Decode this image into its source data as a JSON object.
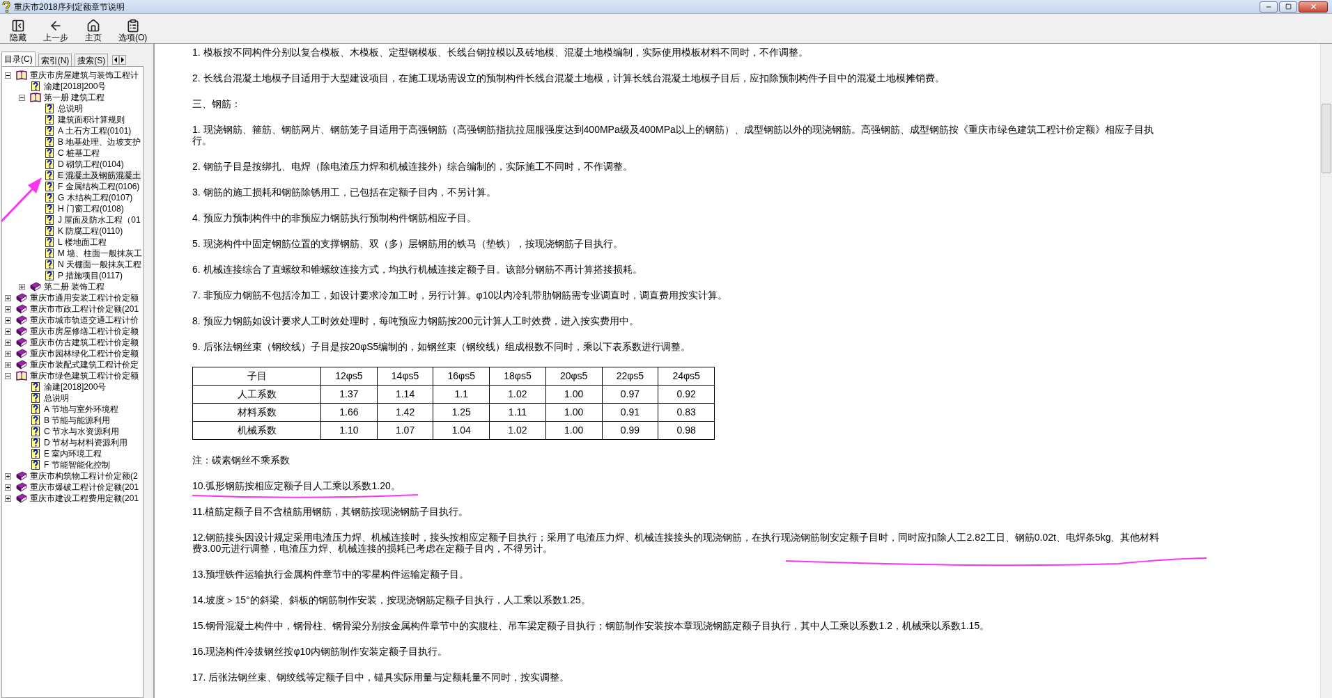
{
  "window": {
    "title": "重庆市2018序列定额章节说明"
  },
  "toolbar": [
    {
      "kind": "hide",
      "label": "隐藏"
    },
    {
      "kind": "back",
      "label": "上一步"
    },
    {
      "kind": "home",
      "label": "主页"
    },
    {
      "kind": "options",
      "label": "选项(O)"
    }
  ],
  "tabs": [
    {
      "label": "目录(C)",
      "selected": true
    },
    {
      "label": "索引(N)",
      "selected": false
    },
    {
      "label": "搜索(S)",
      "selected": false
    }
  ],
  "tree": [
    {
      "label": "重庆市房屋建筑与装饰工程计",
      "kind": "book",
      "expanded": true,
      "selected": false,
      "children": [
        {
          "label": "渝建[2018]200号",
          "kind": "page",
          "selected": false
        },
        {
          "label": "第一册 建筑工程",
          "kind": "book",
          "expanded": true,
          "selected": false,
          "children": [
            {
              "label": "总说明",
              "kind": "page",
              "selected": false
            },
            {
              "label": "建筑面积计算规则",
              "kind": "page",
              "selected": false
            },
            {
              "label": "A 土石方工程(0101)",
              "kind": "page",
              "selected": false
            },
            {
              "label": "B 地基处理、边坡支护",
              "kind": "page",
              "selected": false
            },
            {
              "label": "C 桩基工程",
              "kind": "page",
              "selected": false
            },
            {
              "label": "D 砌筑工程(0104)",
              "kind": "page",
              "selected": false
            },
            {
              "label": "E 混凝土及钢筋混凝土",
              "kind": "page",
              "selected": true
            },
            {
              "label": "F 金属结构工程(0106)",
              "kind": "page",
              "selected": false
            },
            {
              "label": "G 木结构工程(0107)",
              "kind": "page",
              "selected": false
            },
            {
              "label": "H 门窗工程(0108)",
              "kind": "page",
              "selected": false
            },
            {
              "label": "J 屋面及防水工程（01",
              "kind": "page",
              "selected": false
            },
            {
              "label": "K 防腐工程(0110)",
              "kind": "page",
              "selected": false
            },
            {
              "label": "L 楼地面工程",
              "kind": "page",
              "selected": false
            },
            {
              "label": "M 墙、柱面一般抹灰工",
              "kind": "page",
              "selected": false
            },
            {
              "label": "N 天棚面一般抹灰工程",
              "kind": "page",
              "selected": false
            },
            {
              "label": "P 措施项目(0117)",
              "kind": "page",
              "selected": false
            }
          ]
        },
        {
          "label": "第二册 装饰工程",
          "kind": "book",
          "expanded": false,
          "selected": false
        }
      ]
    },
    {
      "label": "重庆市通用安装工程计价定额",
      "kind": "book",
      "expanded": false,
      "selected": false
    },
    {
      "label": "重庆市市政工程计价定额(201",
      "kind": "book",
      "expanded": false,
      "selected": false
    },
    {
      "label": "重庆市城市轨道交通工程计价",
      "kind": "book",
      "expanded": false,
      "selected": false
    },
    {
      "label": "重庆市房屋修缮工程计价定额",
      "kind": "book",
      "expanded": false,
      "selected": false
    },
    {
      "label": "重庆市仿古建筑工程计价定额",
      "kind": "book",
      "expanded": false,
      "selected": false
    },
    {
      "label": "重庆市园林绿化工程计价定额",
      "kind": "book",
      "expanded": false,
      "selected": false
    },
    {
      "label": "重庆市装配式建筑工程计价定",
      "kind": "book",
      "expanded": false,
      "selected": false
    },
    {
      "label": "重庆市绿色建筑工程计价定额",
      "kind": "book",
      "expanded": true,
      "selected": false,
      "children": [
        {
          "label": "渝建[2018]200号",
          "kind": "page",
          "selected": false
        },
        {
          "label": "总说明",
          "kind": "page",
          "selected": false
        },
        {
          "label": "A 节地与室外环境程",
          "kind": "page",
          "selected": false
        },
        {
          "label": "B 节能与能源利用",
          "kind": "page",
          "selected": false
        },
        {
          "label": "C 节水与水资源利用",
          "kind": "page",
          "selected": false
        },
        {
          "label": "D 节材与材料资源利用",
          "kind": "page",
          "selected": false
        },
        {
          "label": "E 室内环境工程",
          "kind": "page",
          "selected": false
        },
        {
          "label": "F 节能智能化控制",
          "kind": "page",
          "selected": false
        }
      ]
    },
    {
      "label": "重庆市构筑物工程计价定额(2",
      "kind": "book",
      "expanded": false,
      "selected": false
    },
    {
      "label": "重庆市爆破工程计价定额(201",
      "kind": "book",
      "expanded": false,
      "selected": false
    },
    {
      "label": "重庆市建设工程费用定额(201",
      "kind": "book",
      "expanded": false,
      "selected": false
    }
  ],
  "content": [
    {
      "kind": "text",
      "text": "1. 模板按不同构件分别以复合模板、木模板、定型钢模板、长线台钢拉模以及砖地模、混凝土地模编制，实际使用模板材料不同时，不作调整。"
    },
    {
      "kind": "text",
      "text": "2. 长线台混凝土地模子目适用于大型建设项目，在施工现场需设立的预制构件长线台混凝土地模，计算长线台混凝土地模子目后，应扣除预制构件子目中的混凝土地模摊销费。"
    },
    {
      "kind": "text",
      "text": "三、钢筋："
    },
    {
      "kind": "text",
      "text": "1. 现浇钢筋、箍筋、钢筋网片、钢筋笼子目适用于高强钢筋（高强钢筋指抗拉屈服强度达到400MPa级及400MPa以上的钢筋）、成型钢筋以外的现浇钢筋。高强钢筋、成型钢筋按《重庆市绿色建筑工程计价定额》相应子目执行。"
    },
    {
      "kind": "text",
      "text": "2. 钢筋子目是按绑扎、电焊（除电渣压力焊和机械连接外）综合编制的，实际施工不同时，不作调整。"
    },
    {
      "kind": "text",
      "text": "3. 钢筋的施工损耗和钢筋除锈用工，已包括在定额子目内，不另计算。"
    },
    {
      "kind": "text",
      "text": "4. 预应力预制构件中的非预应力钢筋执行预制构件钢筋相应子目。"
    },
    {
      "kind": "text",
      "text": "5. 现浇构件中固定钢筋位置的支撑钢筋、双（多）层钢筋用的铁马（垫铁），按现浇钢筋子目执行。"
    },
    {
      "kind": "text",
      "text": "6. 机械连接综合了直螺纹和锥螺纹连接方式，均执行机械连接定额子目。该部分钢筋不再计算搭接损耗。"
    },
    {
      "kind": "text",
      "text": "7. 非预应力钢筋不包括冷加工，如设计要求冷加工时，另行计算。φ10以内冷轧带肋钢筋需专业调直时，调直费用按实计算。"
    },
    {
      "kind": "text",
      "text": "8. 预应力钢筋如设计要求人工时效处理时，每吨预应力钢筋按200元计算人工时效费，进入按实费用中。"
    },
    {
      "kind": "text",
      "text": "9. 后张法钢丝束（钢绞线）子目是按20φS5编制的，如钢丝束（钢绞线）组成根数不同时，乘以下表系数进行调整。"
    },
    {
      "kind": "table",
      "columns": [
        "子目",
        "12φs5",
        "14φs5",
        "16φs5",
        "18φs5",
        "20φs5",
        "22φs5",
        "24φs5"
      ],
      "rows": [
        [
          "人工系数",
          "1.37",
          "1.14",
          "1.1",
          "1.02",
          "1.00",
          "0.97",
          "0.92"
        ],
        [
          "材料系数",
          "1.66",
          "1.42",
          "1.25",
          "1.11",
          "1.00",
          "0.91",
          "0.83"
        ],
        [
          "机械系数",
          "1.10",
          "1.07",
          "1.04",
          "1.02",
          "1.00",
          "0.99",
          "0.98"
        ]
      ]
    },
    {
      "kind": "text",
      "text": "注：碳素钢丝不乘系数"
    },
    {
      "kind": "underlined",
      "text": "10.弧形钢筋按相应定额子目人工乘以系数1.20。"
    },
    {
      "kind": "text",
      "text": "11.植筋定额子目不含植筋用钢筋，其钢筋按现浇钢筋子目执行。"
    },
    {
      "kind": "tail_underlined",
      "text": "12.钢筋接头因设计规定采用电渣压力焊、机械连接时，接头按相应定额子目执行；采用了电渣压力焊、机械连接接头的现浇钢筋，在执行现浇钢筋制安定额子目时，同时应扣除人工2.82工日、钢筋0.02t、电焊条5kg、其他材料费3.00元进行调整，电渣压力焊、机械连接的损耗已考虑在定额子目内，不得另计。"
    },
    {
      "kind": "text",
      "text": "13.预埋铁件运输执行金属构件章节中的零星构件运输定额子目。"
    },
    {
      "kind": "text",
      "text": "14.坡度＞15°的斜梁、斜板的钢筋制作安装，按现浇钢筋定额子目执行，人工乘以系数1.25。"
    },
    {
      "kind": "text",
      "text": "15.钢骨混凝土构件中，钢骨柱、钢骨梁分别按金属构件章节中的实腹柱、吊车梁定额子目执行；钢筋制作安装按本章现浇钢筋定额子目执行，其中人工乘以系数1.2，机械乘以系数1.15。"
    },
    {
      "kind": "text",
      "text": "16.现浇构件冷拔钢丝按φ10内钢筋制作安装定额子目执行。"
    },
    {
      "kind": "text",
      "text": "17. 后张法钢丝束、钢绞线等定额子目中，锚具实际用量与定额耗量不同时，按实调整。"
    }
  ]
}
